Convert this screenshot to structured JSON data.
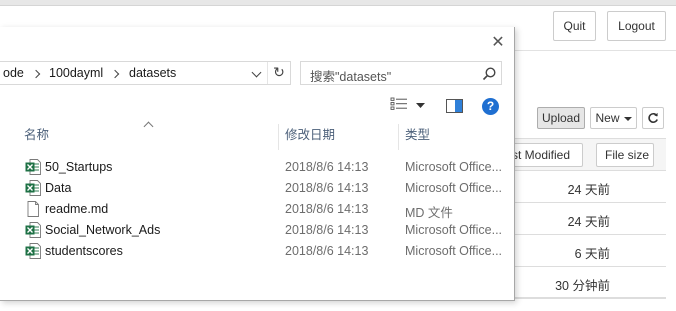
{
  "header": {
    "quit_label": "Quit",
    "logout_label": "Logout"
  },
  "toolbar": {
    "upload_label": "Upload",
    "new_label": "New",
    "refresh_icon": "refresh-icon"
  },
  "file_list": {
    "columns": {
      "last_modified": "st Modified",
      "file_size": "File size"
    },
    "rows": [
      {
        "modified": "24 天前"
      },
      {
        "modified": "24 天前"
      },
      {
        "modified": "6 天前"
      },
      {
        "modified": "30 分钟前"
      }
    ]
  },
  "dialog": {
    "breadcrumb": [
      "ode",
      "100dayml",
      "datasets"
    ],
    "search_placeholder": "搜索\"datasets\"",
    "columns": {
      "name": "名称",
      "date": "修改日期",
      "type": "类型"
    },
    "files": [
      {
        "name": "50_Startups",
        "date": "2018/8/6 14:13",
        "type": "Microsoft Office...",
        "icon": "excel-csv-icon"
      },
      {
        "name": "Data",
        "date": "2018/8/6 14:13",
        "type": "Microsoft Office...",
        "icon": "excel-csv-icon"
      },
      {
        "name": "readme.md",
        "date": "2018/8/6 14:13",
        "type": "MD 文件",
        "icon": "document-icon"
      },
      {
        "name": "Social_Network_Ads",
        "date": "2018/8/6 14:13",
        "type": "Microsoft Office...",
        "icon": "excel-csv-icon"
      },
      {
        "name": "studentscores",
        "date": "2018/8/6 14:13",
        "type": "Microsoft Office...",
        "icon": "excel-csv-icon"
      }
    ]
  },
  "colors": {
    "help_blue": "#1f6fd1",
    "excel_green": "#1e7145",
    "header_text": "#4c607a"
  }
}
